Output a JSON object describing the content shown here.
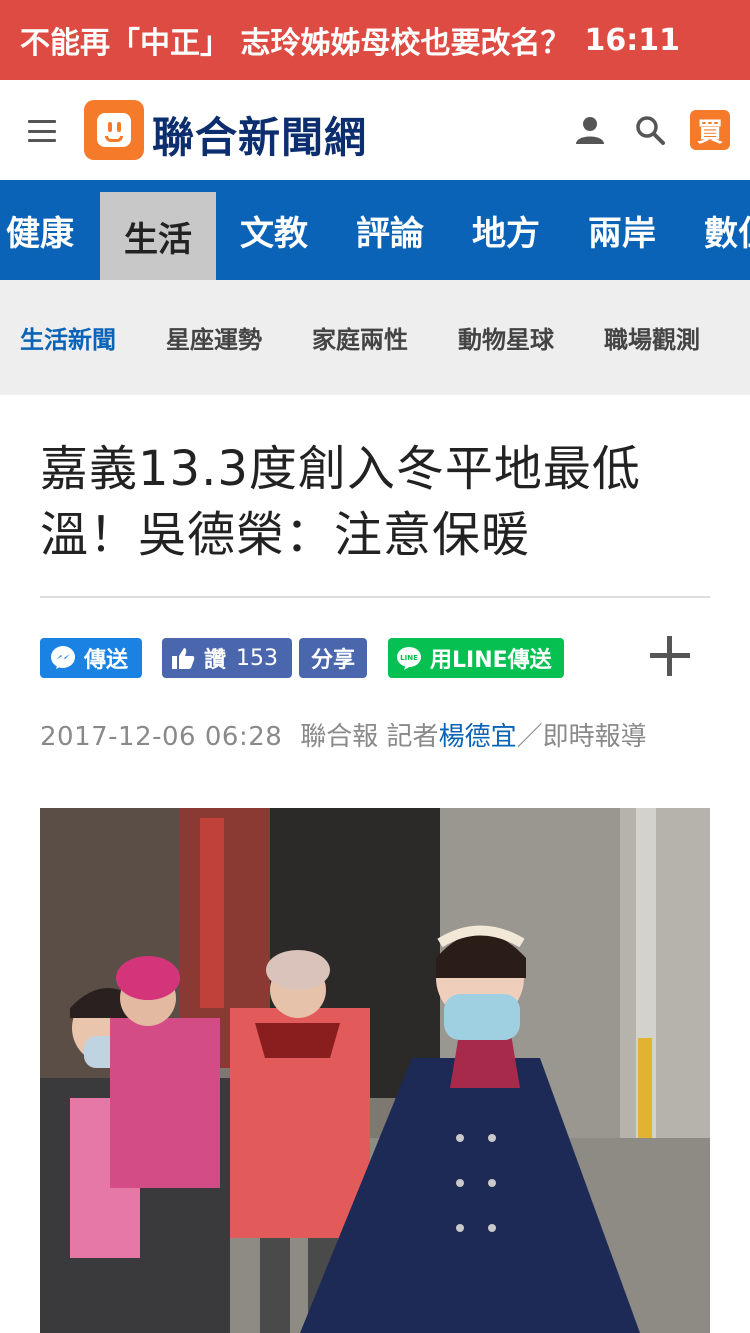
{
  "breaking": {
    "headline": "不能再「中正」 志玲姊姊母校也要改名？",
    "time": "16:11"
  },
  "header": {
    "site_name": "聯合新聞網",
    "buy_label": "買",
    "icons": [
      "menu-icon",
      "user-icon",
      "search-icon"
    ]
  },
  "main_nav": {
    "tabs": [
      "健康",
      "生活",
      "文教",
      "評論",
      "地方",
      "兩岸",
      "數位"
    ],
    "active": "生活"
  },
  "sub_nav": {
    "items": [
      "生活新聞",
      "星座運勢",
      "家庭兩性",
      "動物星球",
      "職場觀測"
    ],
    "active": "生活新聞"
  },
  "article": {
    "title": "嘉義13.3度創入冬平地最低溫！吳德榮：注意保暖",
    "share": {
      "messenger_label": "傳送",
      "like_label": "讚",
      "like_count": "153",
      "share_label": "分享",
      "line_label": "用LINE傳送"
    },
    "meta": {
      "date": "2017-12-06 06:28",
      "source": "聯合報 記者",
      "reporter": "楊德宜",
      "suffix": "／即時報導"
    }
  },
  "colors": {
    "breaking_bg": "#de4b43",
    "brand_orange": "#f57a2a",
    "nav_blue": "#0a63b6",
    "line_green": "#06c152",
    "fb_blue": "#4a66ad",
    "messenger_blue": "#1a82e2"
  }
}
